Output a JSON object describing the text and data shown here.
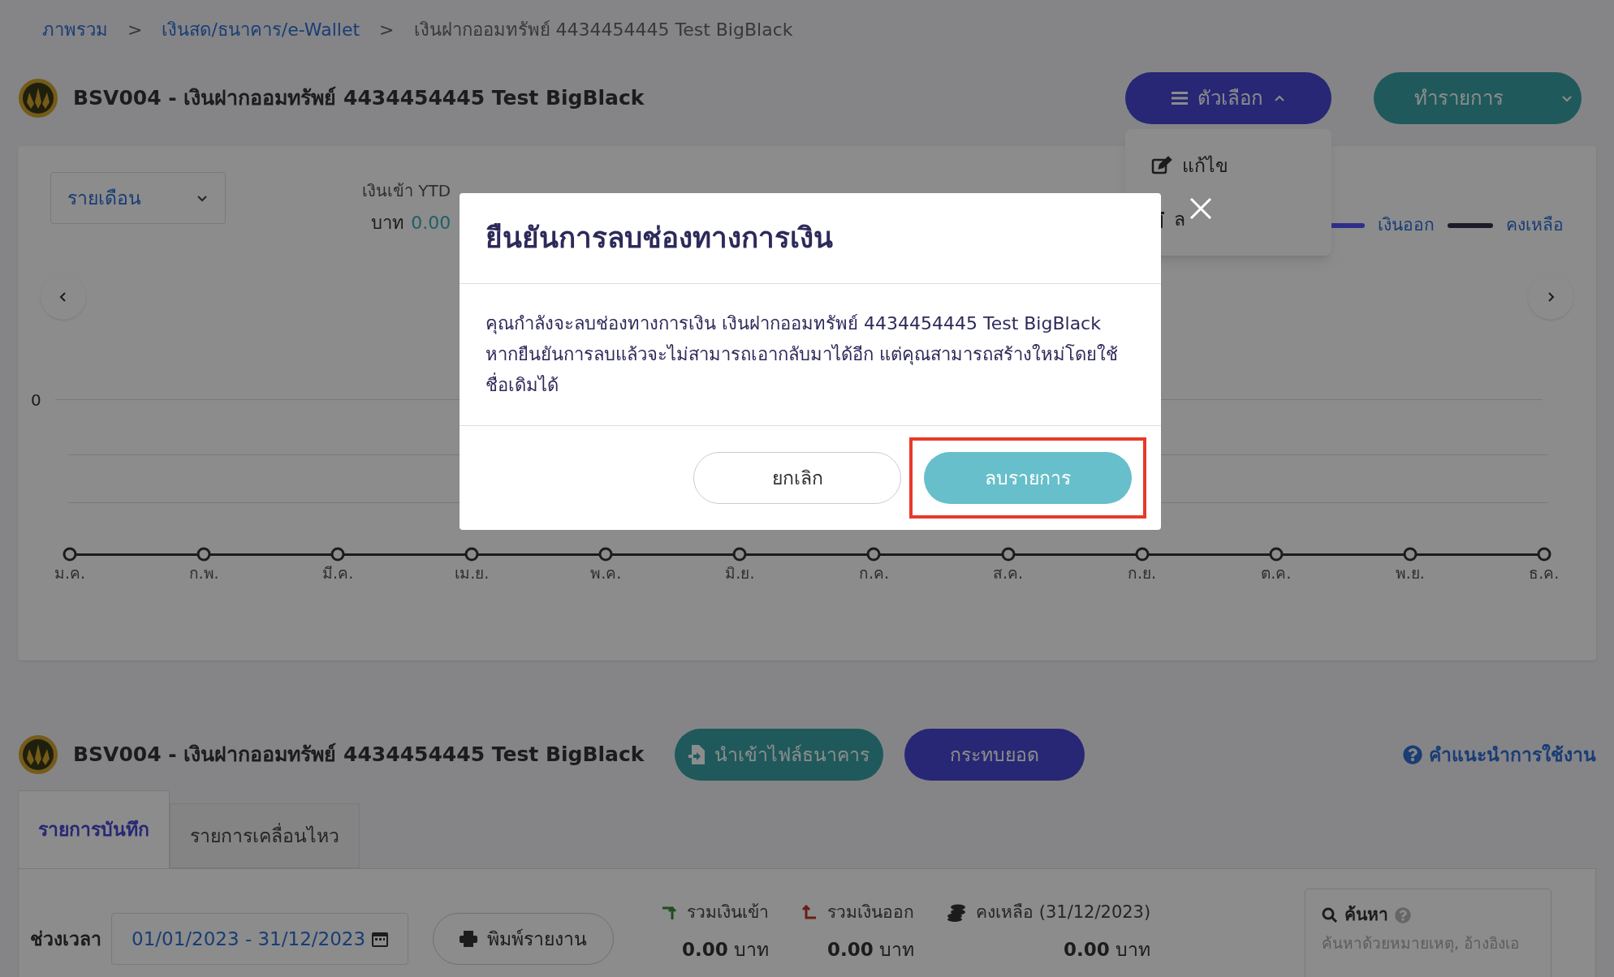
{
  "breadcrumb": [
    {
      "label": "ภาพรวม",
      "link": true
    },
    {
      "label": "เงินสด/ธนาคาร/e-Wallet",
      "link": true
    },
    {
      "label": "เงินฝากออมทรัพย์ 4434454445 Test BigBlack",
      "link": false
    }
  ],
  "breadcrumb_separator": ">",
  "header": {
    "title": "BSV004 - เงินฝากออมทรัพย์ 4434454445 Test BigBlack",
    "options_button": "ตัวเลือก",
    "action_button": "ทำรายการ"
  },
  "options_menu": {
    "expanded": true,
    "items": [
      {
        "label": "แก้ไข",
        "kind": "edit"
      },
      {
        "label": "ล",
        "kind": "delete"
      }
    ]
  },
  "chart_card": {
    "period_select": "รายเดือน",
    "ytd_label": "เงินเข้า YTD",
    "ytd_currency": "บาท",
    "ytd_value": "0.00",
    "legend": [
      {
        "label": "เงินออก",
        "color": "#30308a"
      },
      {
        "label": "คงเหลือ",
        "color": "#1c1c28"
      }
    ],
    "y_tick": "0",
    "months": [
      "ม.ค.",
      "ก.พ.",
      "มี.ค.",
      "เม.ย.",
      "พ.ค.",
      "มิ.ย.",
      "ก.ค.",
      "ส.ค.",
      "ก.ย.",
      "ต.ค.",
      "พ.ย.",
      "ธ.ค."
    ]
  },
  "section": {
    "title": "BSV004 - เงินฝากออมทรัพย์ 4434454445 Test BigBlack",
    "import_button": "นำเข้าไฟล์ธนาคาร",
    "reconcile_button": "กระทบยอด",
    "help_link": "คำแนะนำการใช้งาน"
  },
  "tabs": [
    {
      "label": "รายการบันทึก",
      "selected": true
    },
    {
      "label": "รายการเคลื่อนไหว",
      "selected": false
    }
  ],
  "filters": {
    "period_label": "ช่วงเวลา",
    "date_range": "01/01/2023 - 31/12/2023",
    "print_button": "พิมพ์รายงาน"
  },
  "stats": [
    {
      "label": "รวมเงินเข้า",
      "value": "**0.00** บาท",
      "kind": "in"
    },
    {
      "label": "รวมเงินออก",
      "value": "**0.00** บาท",
      "kind": "out"
    },
    {
      "label": "คงเหลือ (31/12/2023)",
      "value": "**0.00** บาท",
      "kind": "balance"
    }
  ],
  "search": {
    "label": "ค้นหา",
    "placeholder": "ค้นหาด้วยหมายเหตุ, อ้างอิงเอ"
  },
  "dialog": {
    "title": "ยืนยันการลบช่องทางการเงิน",
    "message": "คุณกำลังจะลบช่องทางการเงิน เงินฝากออมทรัพย์ 4434454445 Test BigBlack หากยืนยันการลบแล้วจะไม่สามารถเอากลับมาได้อีก แต่คุณสามารถสร้างใหม่โดยใช้ชื่อเดิมได้",
    "cancel_button": "ยกเลิก",
    "confirm_button": "ลบรายการ",
    "confirm_highlighted": true
  }
}
